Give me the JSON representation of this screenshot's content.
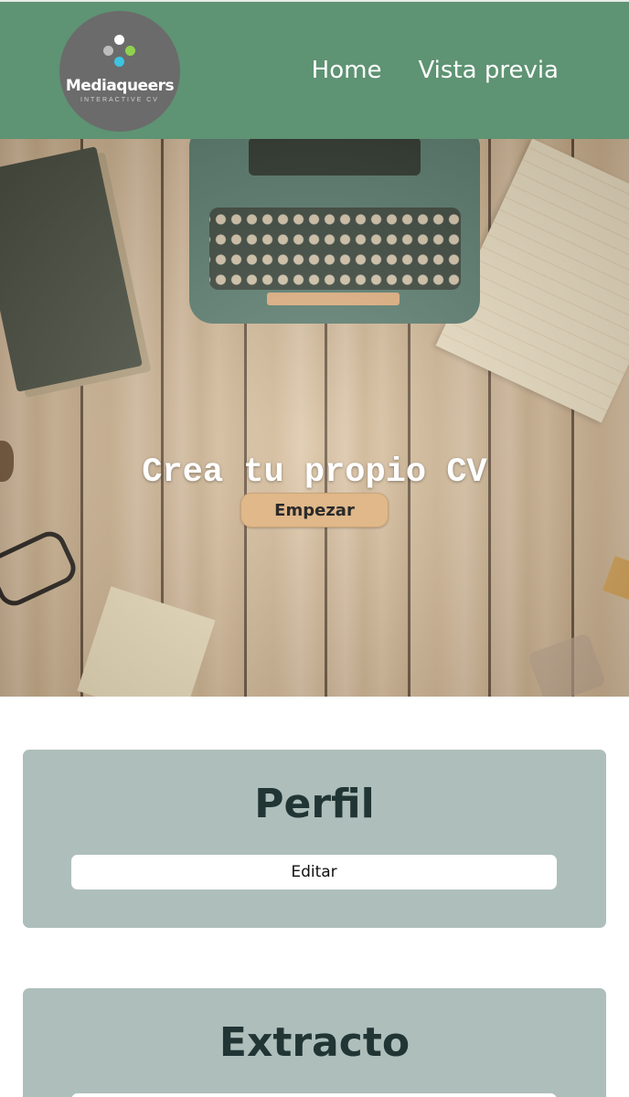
{
  "header": {
    "logo": {
      "name": "Mediaqueers",
      "subtitle": "INTERACTIVE CV"
    },
    "nav": [
      {
        "label": "Home"
      },
      {
        "label": "Vista previa"
      }
    ],
    "colors": {
      "background": "#5e9373"
    }
  },
  "hero": {
    "title": "Crea tu propio CV",
    "button_label": "Empezar",
    "colors": {
      "button": "#e0b88a"
    }
  },
  "sections": [
    {
      "title": "Perfil",
      "button_label": "Editar"
    },
    {
      "title": "Extracto",
      "button_label": ""
    }
  ],
  "colors": {
    "card_background": "#aebfbb",
    "card_title": "#223535"
  }
}
